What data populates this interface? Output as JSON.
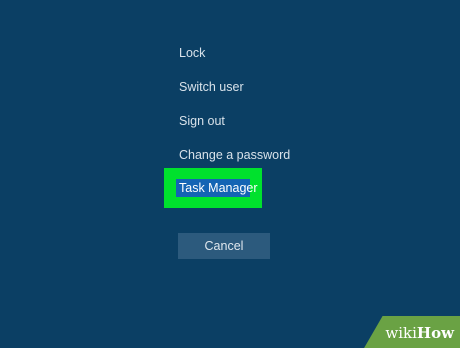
{
  "menu": {
    "items": [
      {
        "label": "Lock"
      },
      {
        "label": "Switch user"
      },
      {
        "label": "Sign out"
      },
      {
        "label": "Change a password"
      },
      {
        "label": "Task Manager"
      }
    ]
  },
  "cancel_label": "Cancel",
  "watermark": {
    "part1": "wiki",
    "part2": "How"
  },
  "colors": {
    "background": "#0b3f64",
    "highlight": "#00e12d",
    "selection": "#1464b4",
    "cancel_button": "#2c5a7d",
    "watermark": "#6aa244"
  }
}
